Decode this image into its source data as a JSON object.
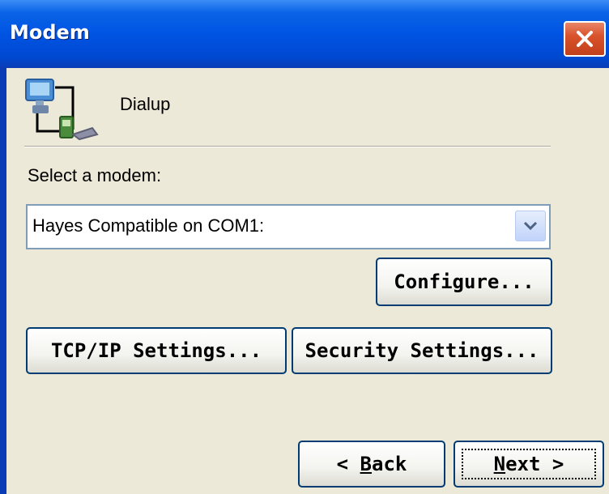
{
  "window": {
    "title": "Modem"
  },
  "connection": {
    "name": "Dialup"
  },
  "modem": {
    "label": "Select a modem:",
    "selected": "Hayes Compatible on COM1:"
  },
  "buttons": {
    "configure": "Configure...",
    "tcpip": "TCP/IP Settings...",
    "security": "Security Settings...",
    "back_prefix": "< ",
    "back_mnemonic": "B",
    "back_rest": "ack",
    "next_mnemonic": "N",
    "next_rest": "ext >"
  },
  "icons": {
    "close": "close-icon",
    "dialup": "network-connection-icon",
    "dropdown": "chevron-down-icon"
  },
  "colors": {
    "titlebar": "#0054e3",
    "close": "#d9532c",
    "background": "#ece9d8"
  }
}
